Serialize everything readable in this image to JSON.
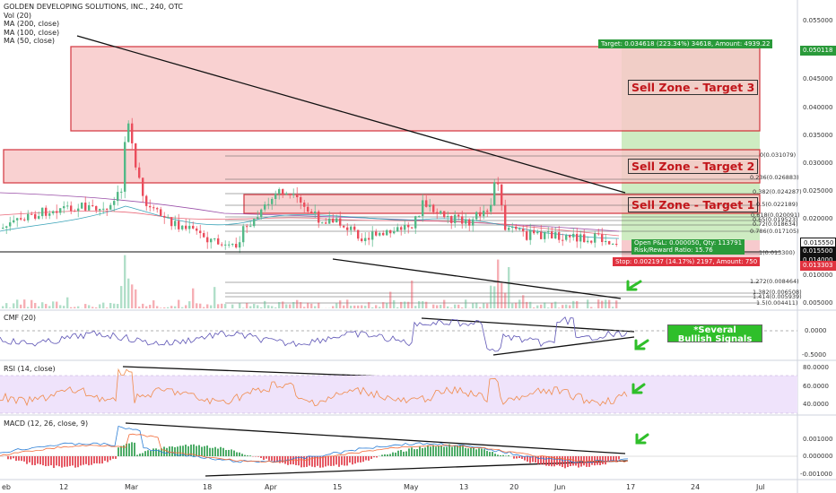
{
  "legend": {
    "title": "GOLDEN DEVELOPING SOLUTIONS, INC., 240, OTC",
    "vol": "Vol (20)",
    "ma200": "MA (200, close)",
    "ma100": "MA (100, close)",
    "ma50": "MA (50, close)"
  },
  "panes": {
    "cmf": "CMF (20)",
    "rsi": "RSI (14, close)",
    "macd": "MACD (12, 26, close, 9)"
  },
  "zones": {
    "target3": "Sell Zone - Target 3",
    "target2": "Sell Zone - Target 2",
    "target1": "Sell Zone - Target 1"
  },
  "fib": {
    "l0": "0(0.031079)",
    "l236": "0.236(0.026883)",
    "l382": "0.382(0.024287)",
    "l5": "0.5(0.022189)",
    "l618": "0.618(0.020091)",
    "l65": "0.65(0.019523)",
    "l705": "0.705(0.018546)",
    "l72": "0.72(0.018634)",
    "l786": "0.786(0.017105)",
    "l1": "1(0.013300)",
    "l1272": "1.272(0.008464)",
    "l1382": "1.382(0.006508)",
    "l1414": "1.414(0.005939)",
    "l1500": "1.5(0.004411)"
  },
  "notes": {
    "target": "Target: 0.034618 (223.34%) 34618, Amount: 4939.22",
    "open_pl": "Open P&L: 0.000050, Qty: 113791",
    "risk_reward": "Risk/Reward Ratio: 15.76",
    "stop": "Stop: 0.002197 (14.17%) 2197, Amount: 750",
    "bullish_line1": "*Several",
    "bullish_line2": "Bullish Signals"
  },
  "price_axis": {
    "ticks": [
      "0.055000",
      "0.045000",
      "0.040000",
      "0.035000",
      "0.030000",
      "0.025000",
      "0.020000",
      "0.010000",
      "0.005000"
    ],
    "tags": {
      "target": "0.050118",
      "current": "0.015550",
      "entry": "0.015500",
      "marker": "0.014000",
      "stop": "0.013303"
    }
  },
  "cmf_axis": [
    "0.0000",
    "-0.5000"
  ],
  "rsi_axis": [
    "80.0000",
    "60.0000",
    "40.0000"
  ],
  "macd_axis": [
    "0.001000",
    "0.000000",
    "-0.001000"
  ],
  "time_axis": [
    "eb",
    "12",
    "Mar",
    "18",
    "Apr",
    "15",
    "May",
    "13",
    "20",
    "Jun",
    "17",
    "24",
    "Jul"
  ],
  "colors": {
    "up": "#53b987",
    "down": "#eb4d5c",
    "zone_fill": "#f8c9c9",
    "zone_border": "#d0212b",
    "target_area": "#a6dd8f",
    "rsi_fill": "#efe3fb",
    "signal_green": "#2fbf2a"
  }
}
